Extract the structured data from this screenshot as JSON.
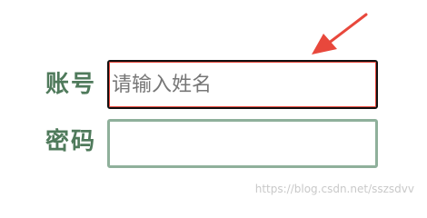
{
  "form": {
    "account_label": "账号",
    "account_placeholder": "请输入姓名",
    "account_value": "",
    "password_label": "密码",
    "password_placeholder": "",
    "password_value": ""
  },
  "annotation": {
    "icon": "pointer-arrow",
    "color": "#e8483c"
  },
  "watermark": "https://blog.csdn.net/sszsdvv",
  "colors": {
    "label": "#4f7a5b",
    "focused_border": "#e8483c",
    "field_border": "#8fb09b"
  }
}
